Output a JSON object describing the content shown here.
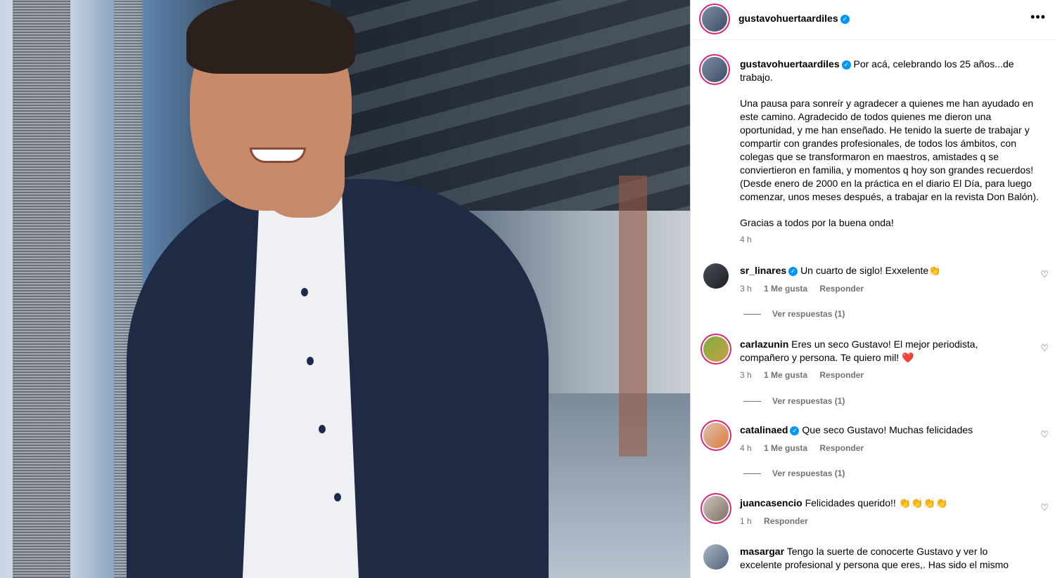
{
  "post": {
    "username": "gustavohuertaardiles",
    "caption_first": "Por acá, celebrando los 25 años...de trabajo.",
    "caption_para2": "Una pausa para sonreír y agradecer a quienes me han ayudado en este camino. Agradecido de todos quienes me dieron una oportunidad, y me han enseñado. He tenido la suerte de trabajar y compartir con grandes profesionales, de todos los ámbitos, con colegas que se transformaron en maestros, amistades q se conviertieron en familia, y momentos q hoy son grandes recuerdos! (Desde enero de 2000 en la práctica en el diario El Día, para luego comenzar, unos meses después, a trabajar en la revista Don Balón).",
    "caption_para3": "Gracias a todos por la buena onda!",
    "time": "4 h"
  },
  "icons": {
    "more": "more-horizontal-icon",
    "heart": "heart-outline-icon",
    "verified": "verified-badge-icon"
  },
  "colors": {
    "verified": "#0095f6",
    "ring": "#d62976",
    "meta": "#737373"
  },
  "comments": [
    {
      "username": "sr_linares",
      "verified": true,
      "text": "Un cuarto de siglo! Exxelente👏",
      "time": "3 h",
      "likes": "1 Me gusta",
      "reply": "Responder",
      "view_replies": "Ver respuestas (1)"
    },
    {
      "username": "carlazunin",
      "verified": false,
      "text": "Eres un seco Gustavo! El mejor periodista, compañero y persona. Te quiero mil! ❤️",
      "time": "3 h",
      "likes": "1 Me gusta",
      "reply": "Responder",
      "view_replies": "Ver respuestas (1)"
    },
    {
      "username": "catalinaed",
      "verified": true,
      "text": "Que seco Gustavo! Muchas felicidades",
      "time": "4 h",
      "likes": "1 Me gusta",
      "reply": "Responder",
      "view_replies": "Ver respuestas (1)"
    },
    {
      "username": "juancasencio",
      "verified": false,
      "text": "Felicidades querido!! 👏👏👏👏",
      "time": "1 h",
      "likes": "",
      "reply": "Responder",
      "view_replies": ""
    },
    {
      "username": "masargar",
      "verified": false,
      "text": "Tengo la suerte de conocerte Gustavo y ver lo excelente profesional y persona que eres,. Has sido el mismo",
      "time": "",
      "likes": "",
      "reply": "",
      "view_replies": ""
    }
  ]
}
